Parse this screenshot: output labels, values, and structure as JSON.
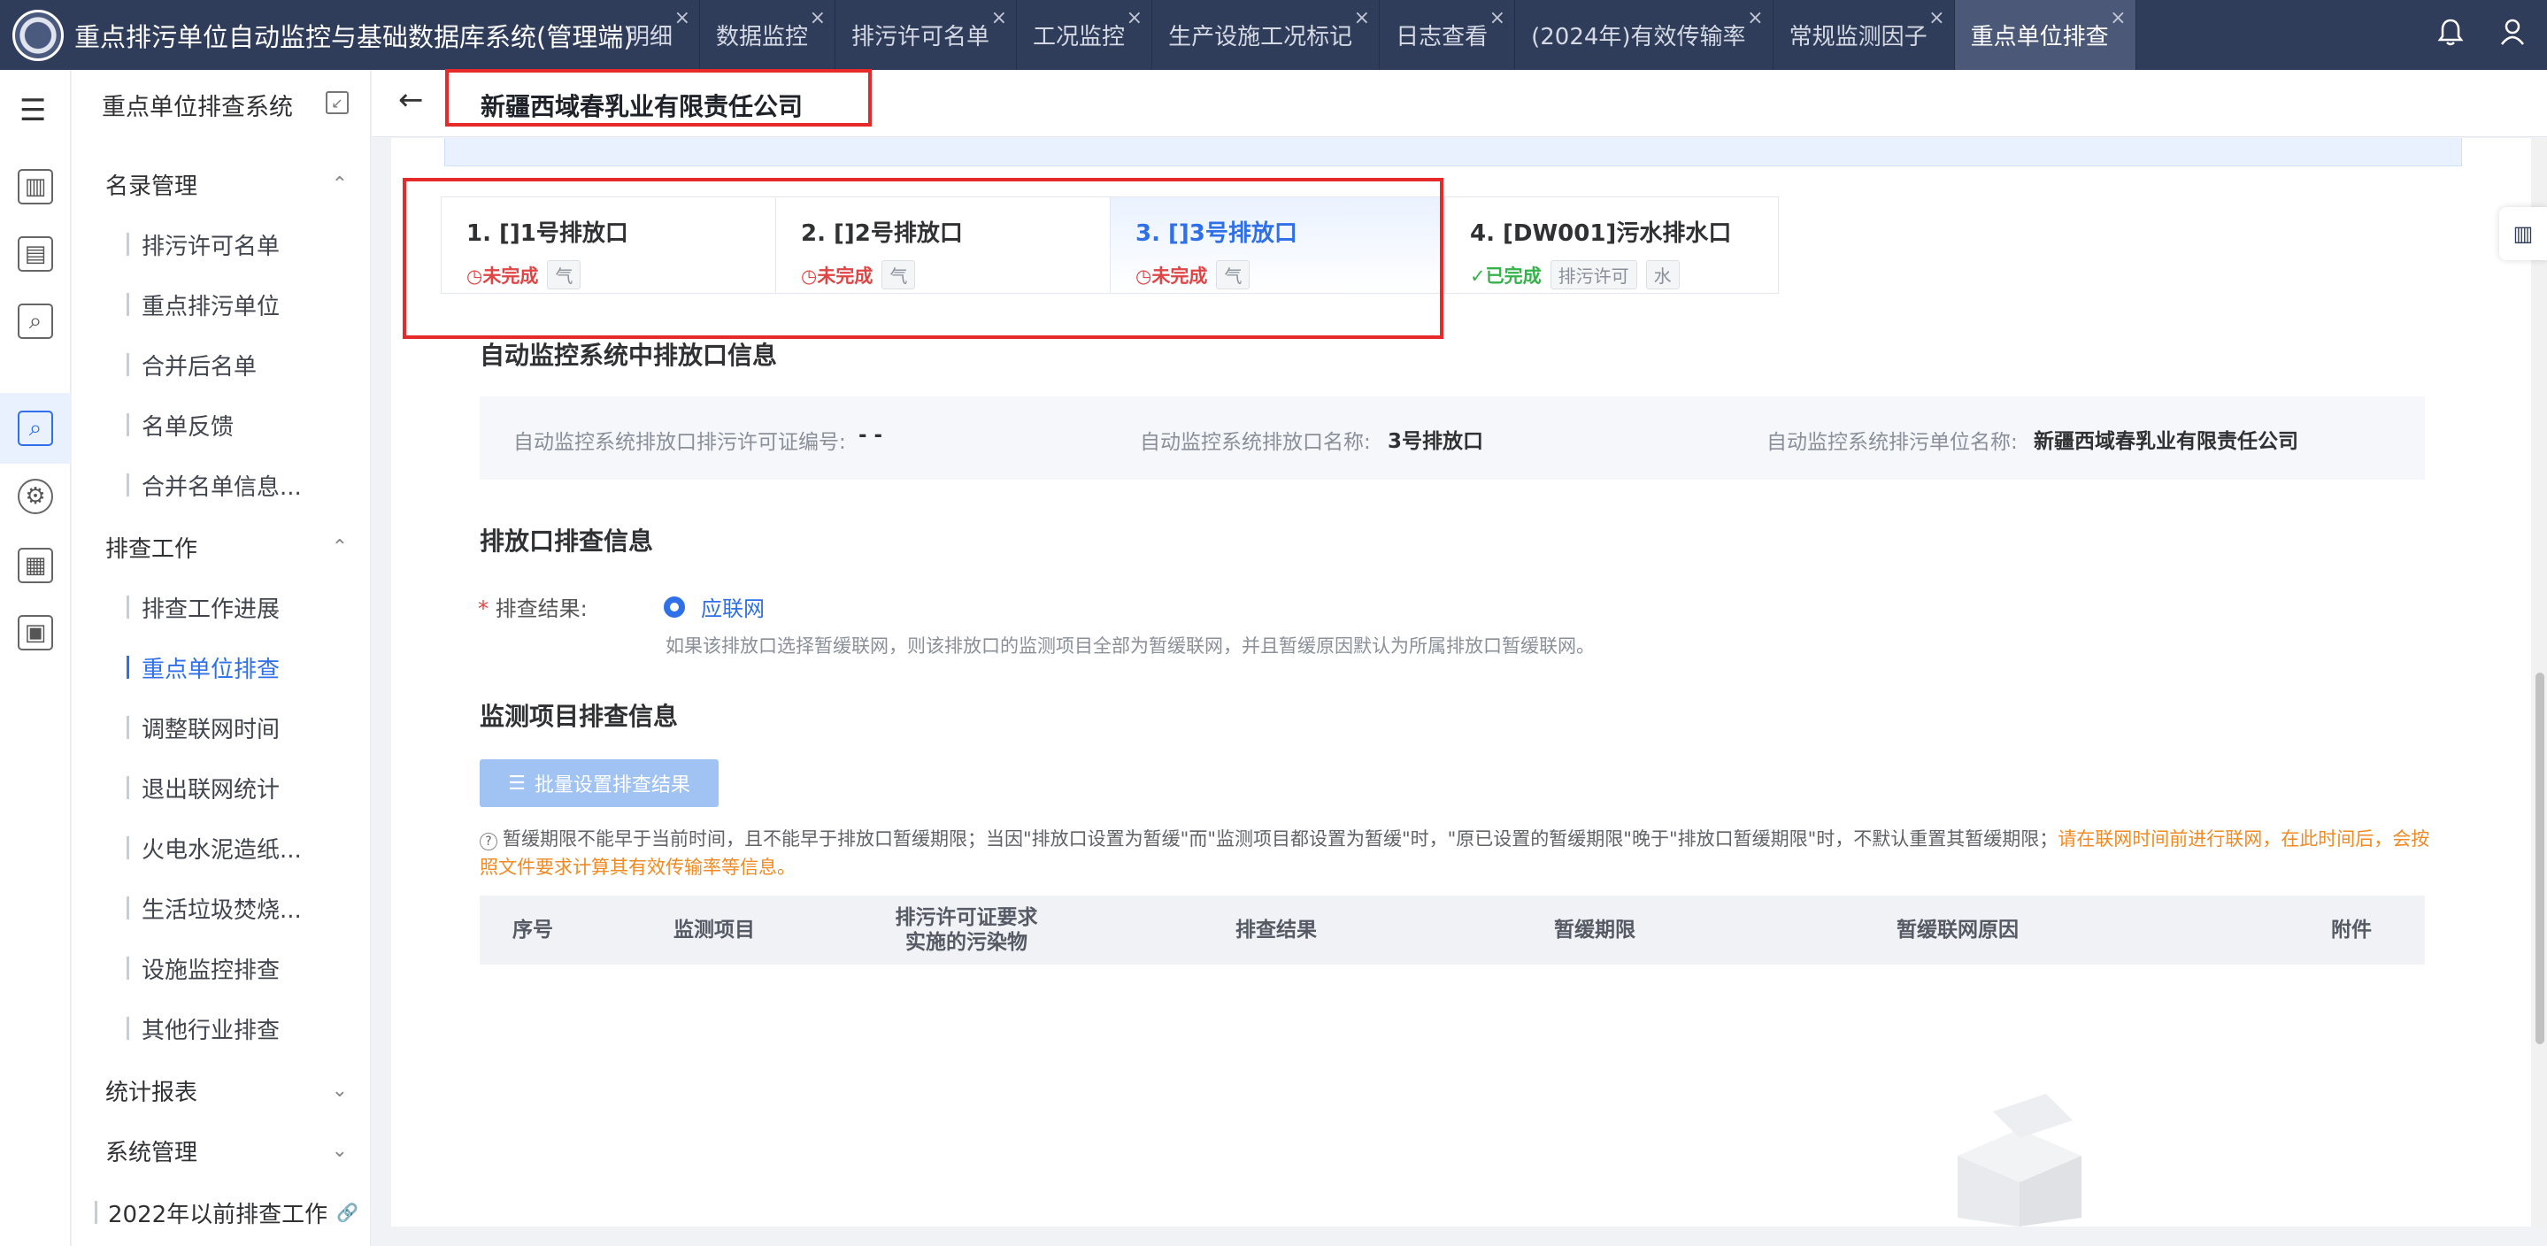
{
  "app": {
    "title": "重点排污单位自动监控与基础数据库系统(管理端)"
  },
  "tabs": [
    {
      "label": "明细",
      "active": false
    },
    {
      "label": "数据监控",
      "active": false
    },
    {
      "label": "排污许可名单",
      "active": false
    },
    {
      "label": "工况监控",
      "active": false
    },
    {
      "label": "生产设施工况标记",
      "active": false
    },
    {
      "label": "日志查看",
      "active": false
    },
    {
      "label": "(2024年)有效传输率",
      "active": false
    },
    {
      "label": "常规监测因子",
      "active": false
    },
    {
      "label": "重点单位排查",
      "active": true
    }
  ],
  "icons": {
    "close": "×",
    "bell": "bell-icon",
    "user": "user-icon",
    "back": "←",
    "menu": "☰",
    "chevron_up": "⌃",
    "chevron_down": "⌄",
    "link": "🔗",
    "help": "?",
    "list": "☰"
  },
  "sidebar": {
    "header": "重点单位排查系统",
    "groups": [
      {
        "label": "名录管理",
        "expanded": true,
        "items": [
          "排污许可名单",
          "重点排污单位",
          "合并后名单",
          "名单反馈",
          "合并名单信息..."
        ]
      },
      {
        "label": "排查工作",
        "expanded": true,
        "items": [
          "排查工作进展",
          "重点单位排查",
          "调整联网时间",
          "退出联网统计",
          "火电水泥造纸...",
          "生活垃圾焚烧...",
          "设施监控排查",
          "其他行业排查"
        ]
      },
      {
        "label": "统计报表",
        "expanded": false,
        "items": []
      },
      {
        "label": "系统管理",
        "expanded": false,
        "items": []
      }
    ],
    "active_item": "重点单位排查",
    "link": "2022年以前排查工作"
  },
  "page": {
    "company": "新疆西域春乳业有限责任公司"
  },
  "outlets": [
    {
      "label": "1. []1号排放口",
      "status": "未完成",
      "status_type": "todo",
      "tags": [
        "气"
      ],
      "active": false
    },
    {
      "label": "2. []2号排放口",
      "status": "未完成",
      "status_type": "todo",
      "tags": [
        "气"
      ],
      "active": false
    },
    {
      "label": "3. []3号排放口",
      "status": "未完成",
      "status_type": "todo",
      "tags": [
        "气"
      ],
      "active": true
    },
    {
      "label": "4. [DW001]污水排水口",
      "status": "已完成",
      "status_type": "done",
      "tags": [
        "排污许可",
        "水"
      ],
      "active": false
    }
  ],
  "auto_info": {
    "title": "自动监控系统中排放口信息",
    "permit_label": "自动监控系统排放口排污许可证编号:",
    "permit_value": "- -",
    "name_label": "自动监控系统排放口名称:",
    "name_value": "3号排放口",
    "unit_label": "自动监控系统排污单位名称:",
    "unit_value": "新疆西域春乳业有限责任公司"
  },
  "check_info": {
    "title": "排放口排查信息",
    "result_label": "排查结果:",
    "result_option": "应联网",
    "hint": "如果该排放口选择暂缓联网，则该排放口的监测项目全部为暂缓联网，并且暂缓原因默认为所属排放口暂缓联网。"
  },
  "monitor_info": {
    "title": "监测项目排查信息",
    "batch_button": "批量设置排查结果",
    "note": "暂缓期限不能早于当前时间，且不能早于排放口暂缓期限；当因\"排放口设置为暂缓\"而\"监测项目都设置为暂缓\"时，\"原已设置的暂缓期限\"晚于\"排放口暂缓期限\"时，不默认重置其暂缓期限；",
    "warning": "请在联网时间前进行联网，在此时间后，会按照文件要求计算其有效传输率等信息。",
    "columns": [
      "序号",
      "监测项目",
      "排污许可证要求\n实施的污染物",
      "排查结果",
      "暂缓期限",
      "暂缓联网原因",
      "附件"
    ]
  },
  "colors": {
    "topbar": "#2f3c5a",
    "accent": "#2f6fe8",
    "danger": "#e04545",
    "success": "#34b34a",
    "warning": "#f08a24",
    "highlight_box": "#e62a2a"
  }
}
